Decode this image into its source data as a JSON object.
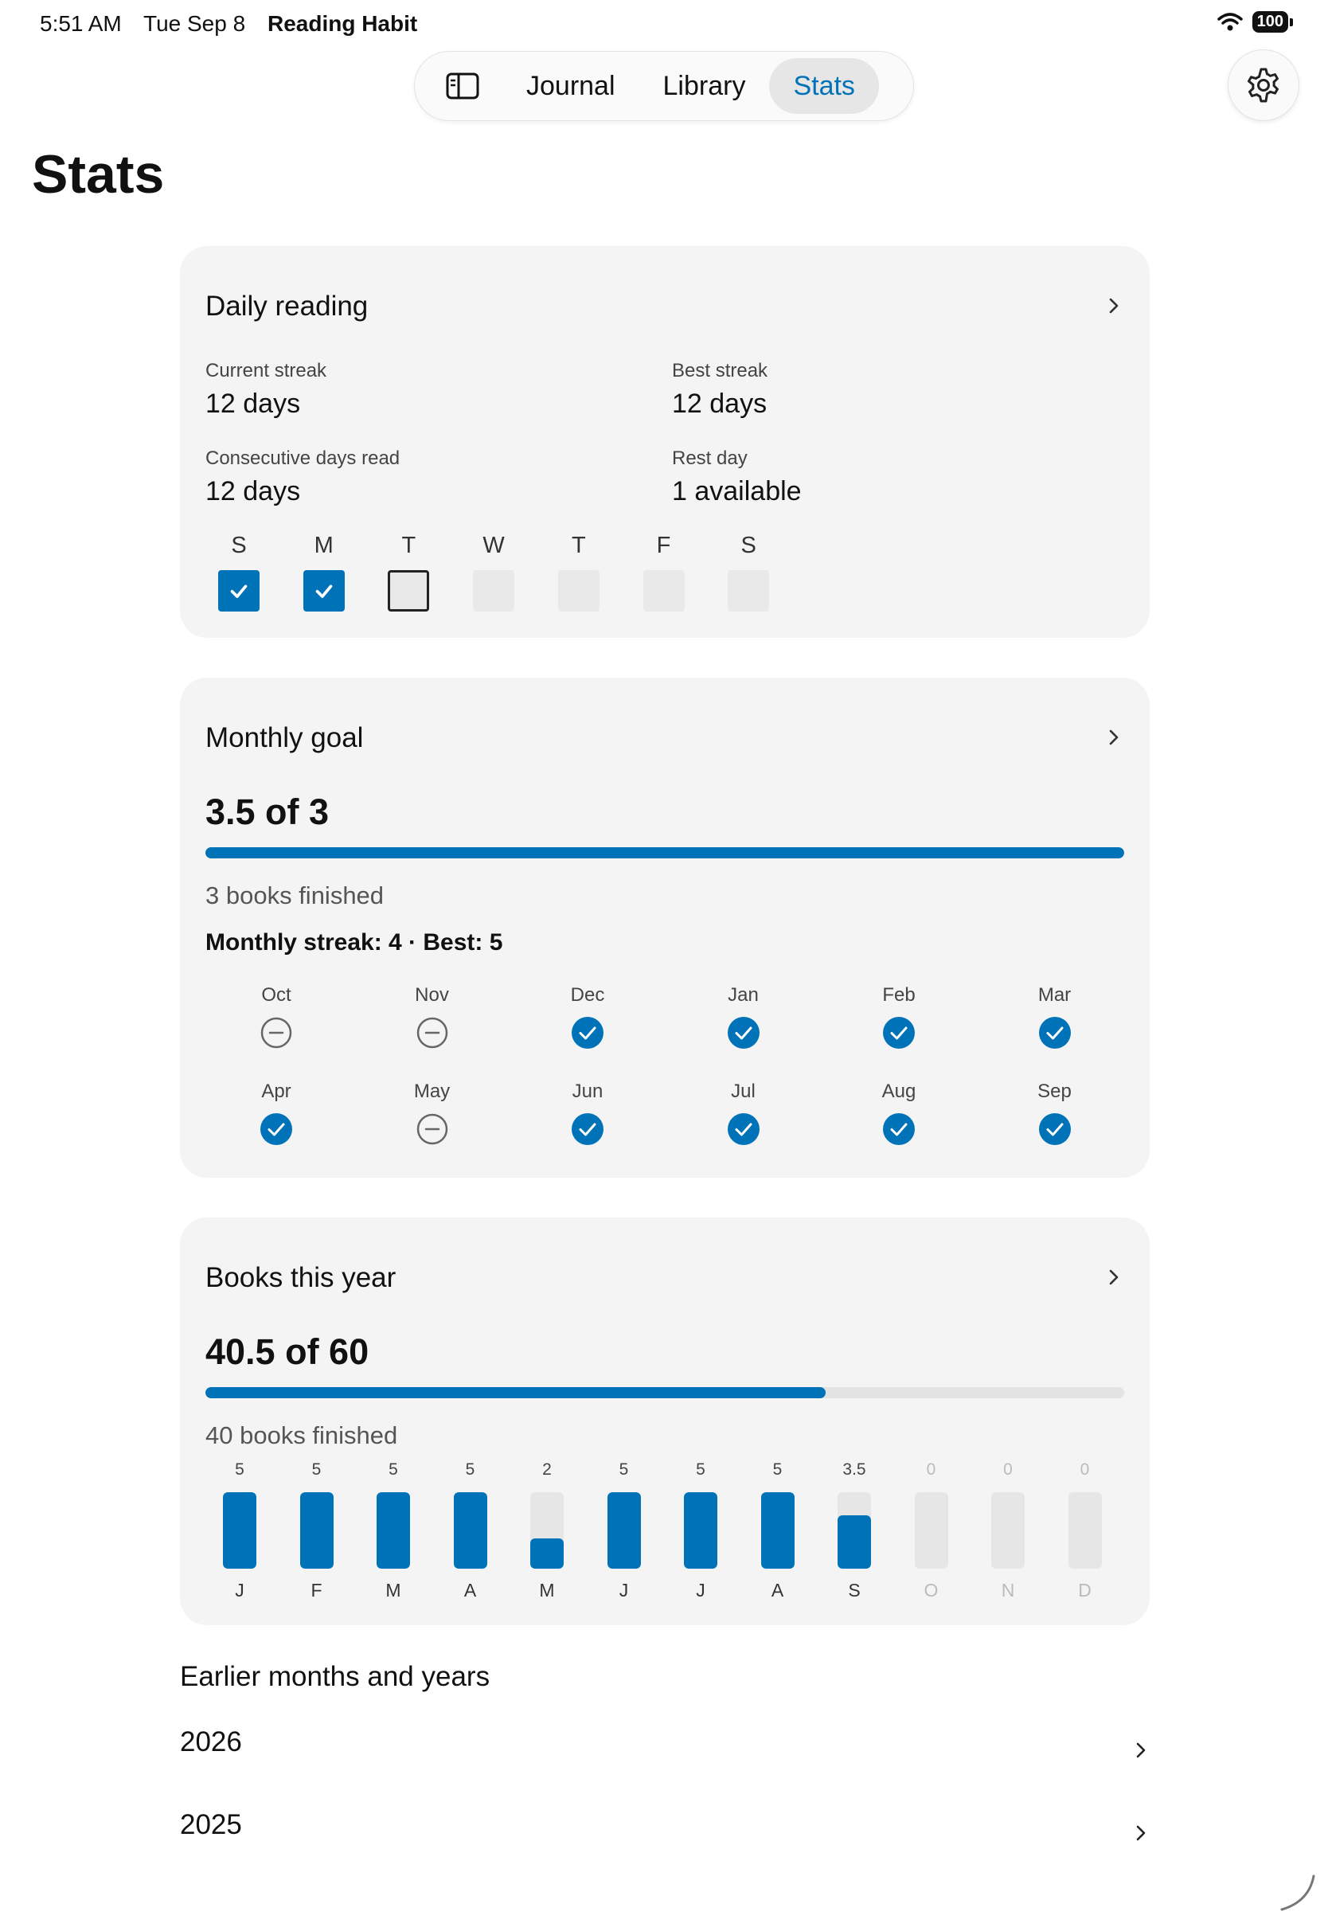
{
  "status_bar": {
    "time": "5:51 AM",
    "date": "Tue Sep 8",
    "app_name": "Reading Habit",
    "battery": "100"
  },
  "nav": {
    "tabs": [
      {
        "label": "Journal"
      },
      {
        "label": "Library"
      },
      {
        "label": "Stats",
        "active": true
      }
    ]
  },
  "page_title": "Stats",
  "colors": {
    "accent": "#0072b8",
    "card_bg": "#f4f4f4",
    "track": "#e3e3e3"
  },
  "daily_reading": {
    "title": "Daily reading",
    "current_streak_label": "Current streak",
    "current_streak_value": "12 days",
    "best_streak_label": "Best streak",
    "best_streak_value": "12 days",
    "consecutive_label": "Consecutive days read",
    "consecutive_value": "12 days",
    "rest_day_label": "Rest day",
    "rest_day_value": "1 available",
    "days": [
      {
        "letter": "S",
        "state": "done"
      },
      {
        "letter": "M",
        "state": "done"
      },
      {
        "letter": "T",
        "state": "today"
      },
      {
        "letter": "W",
        "state": "future"
      },
      {
        "letter": "T",
        "state": "future"
      },
      {
        "letter": "F",
        "state": "future"
      },
      {
        "letter": "S",
        "state": "future"
      }
    ]
  },
  "monthly_goal": {
    "title": "Monthly goal",
    "progress_text": "3.5 of 3",
    "progress": 1.0,
    "finished_text": "3 books finished",
    "streak_text": "Monthly streak: 4 · Best: 5",
    "months": [
      {
        "label": "Oct",
        "state": "missed"
      },
      {
        "label": "Nov",
        "state": "missed"
      },
      {
        "label": "Dec",
        "state": "done"
      },
      {
        "label": "Jan",
        "state": "done"
      },
      {
        "label": "Feb",
        "state": "done"
      },
      {
        "label": "Mar",
        "state": "done"
      },
      {
        "label": "Apr",
        "state": "done"
      },
      {
        "label": "May",
        "state": "missed"
      },
      {
        "label": "Jun",
        "state": "done"
      },
      {
        "label": "Jul",
        "state": "done"
      },
      {
        "label": "Aug",
        "state": "done"
      },
      {
        "label": "Sep",
        "state": "done"
      }
    ]
  },
  "books_this_year": {
    "title": "Books this year",
    "progress_text": "40.5 of 60",
    "progress": 0.675,
    "finished_text": "40 books finished"
  },
  "chart_data": {
    "type": "bar",
    "categories": [
      "J",
      "F",
      "M",
      "A",
      "M",
      "J",
      "J",
      "A",
      "S",
      "O",
      "N",
      "D"
    ],
    "values": [
      5,
      5,
      5,
      5,
      2,
      5,
      5,
      5,
      3.5,
      0,
      0,
      0
    ],
    "value_labels": [
      "5",
      "5",
      "5",
      "5",
      "2",
      "5",
      "5",
      "5",
      "3.5",
      "0",
      "0",
      "0"
    ],
    "future": [
      false,
      false,
      false,
      false,
      false,
      false,
      false,
      false,
      false,
      true,
      true,
      true
    ],
    "ylim": [
      0,
      5
    ],
    "grid": false
  },
  "earlier": {
    "heading": "Earlier months and years",
    "years": [
      {
        "label": "2026"
      },
      {
        "label": "2025"
      }
    ]
  }
}
